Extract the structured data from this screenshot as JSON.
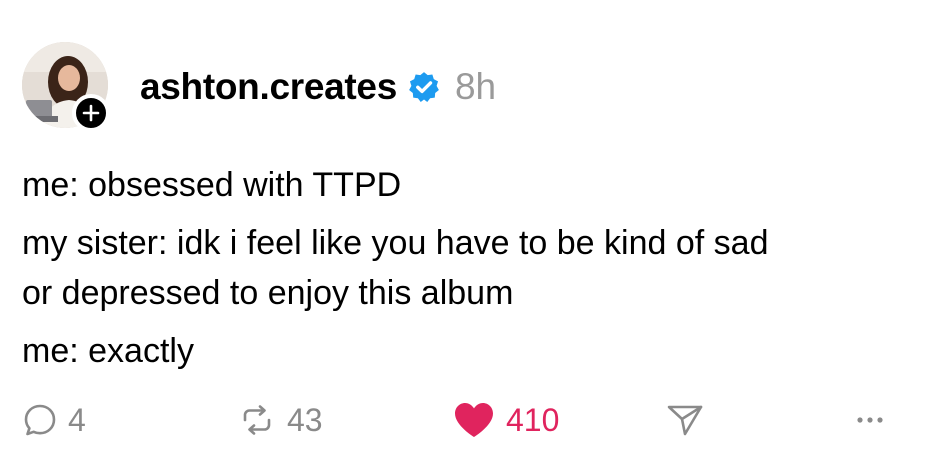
{
  "post": {
    "username": "ashton.creates",
    "verified": true,
    "timestamp": "8h",
    "lines": [
      "me: obsessed with TTPD",
      "my sister: idk i feel like you have to be kind of sad",
      "or depressed to enjoy this album",
      "me: exactly"
    ]
  },
  "actions": {
    "reply_count": "4",
    "repost_count": "43",
    "like_count": "410",
    "liked": true
  },
  "colors": {
    "verified_blue": "#1d9bf0",
    "like_red": "#e0245e",
    "muted_gray": "#8a8a8a",
    "timestamp_gray": "#9a9a9a"
  },
  "icons": {
    "follow": "plus-icon",
    "verified": "verified-badge-icon",
    "reply": "speech-bubble-icon",
    "repost": "repost-arrows-icon",
    "like": "heart-icon",
    "share": "paper-plane-icon",
    "more": "ellipsis-icon"
  }
}
